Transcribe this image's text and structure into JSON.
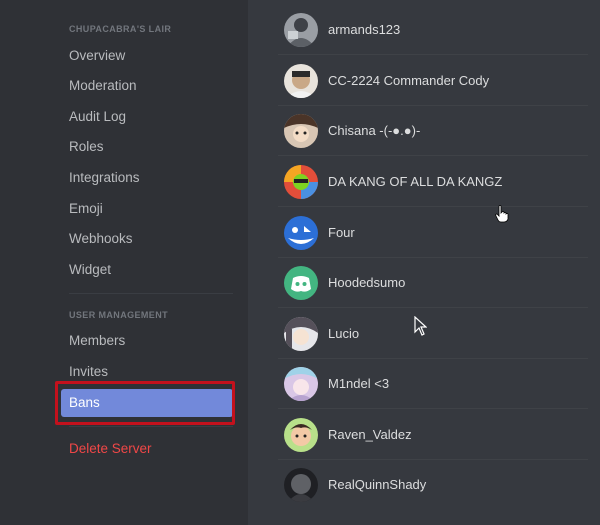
{
  "sidebar": {
    "server_header": "CHUPACABRA'S LAIR",
    "items": [
      {
        "label": "Overview"
      },
      {
        "label": "Moderation"
      },
      {
        "label": "Audit Log"
      },
      {
        "label": "Roles"
      },
      {
        "label": "Integrations"
      },
      {
        "label": "Emoji"
      },
      {
        "label": "Webhooks"
      },
      {
        "label": "Widget"
      }
    ],
    "user_management_header": "USER MANAGEMENT",
    "user_items": [
      {
        "label": "Members"
      },
      {
        "label": "Invites"
      },
      {
        "label": "Bans",
        "selected": true
      }
    ],
    "delete_label": "Delete Server"
  },
  "bans": [
    {
      "username": "armands123",
      "avatar": "photo-avatar"
    },
    {
      "username": "CC-2224 Commander Cody",
      "avatar": "photo-avatar"
    },
    {
      "username": "Chisana -(-●.●)-",
      "avatar": "anime-avatar"
    },
    {
      "username": "DA KANG OF ALL DA KANGZ",
      "avatar": "colorful-avatar"
    },
    {
      "username": "Four",
      "avatar": "blue-cartoon-avatar"
    },
    {
      "username": "Hoodedsumo",
      "avatar": "default-discord-avatar"
    },
    {
      "username": "Lucio",
      "avatar": "anime-avatar"
    },
    {
      "username": "M1ndel <3",
      "avatar": "anime-avatar"
    },
    {
      "username": "Raven_Valdez",
      "avatar": "cartoon-avatar"
    },
    {
      "username": "RealQuinnShady",
      "avatar": "dark-photo-avatar"
    }
  ],
  "colors": {
    "selected_bg": "#7289da",
    "danger": "#f04747",
    "highlight_box": "#c3111d",
    "default_avatar": "#43b581"
  }
}
